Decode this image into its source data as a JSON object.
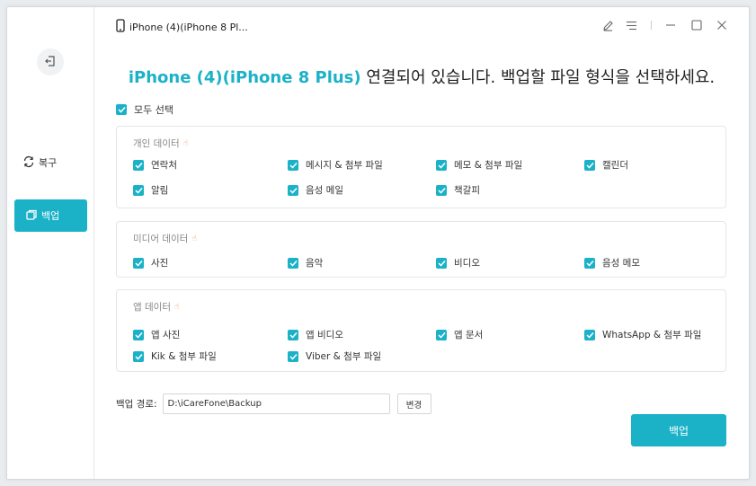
{
  "device": {
    "name": "iPhone (4)(iPhone 8 Pl..."
  },
  "sidebar": {
    "restore_label": "복구",
    "backup_label": "백업"
  },
  "headline": {
    "device_highlight": "iPhone (4)(iPhone 8 Plus)",
    "message": " 연결되어 있습니다. 백업할 파일 형식을 선택하세요."
  },
  "select_all": {
    "label": "모두 선택",
    "checked": true
  },
  "groups": [
    {
      "title": "개인 데이터",
      "items": [
        {
          "label": "연락처",
          "checked": true
        },
        {
          "label": "메시지 & 첨부 파일",
          "checked": true
        },
        {
          "label": "메모 & 첨부 파일",
          "checked": true
        },
        {
          "label": "캘린더",
          "checked": true
        },
        {
          "label": "알림",
          "checked": true
        },
        {
          "label": "음성 메일",
          "checked": true
        },
        {
          "label": "책갈피",
          "checked": true
        }
      ]
    },
    {
      "title": "미디어 데이터",
      "items": [
        {
          "label": "사진",
          "checked": true
        },
        {
          "label": "음악",
          "checked": true
        },
        {
          "label": "비디오",
          "checked": true
        },
        {
          "label": "음성 메모",
          "checked": true
        }
      ]
    },
    {
      "title": "앱 데이터",
      "items": [
        {
          "label": "앱 사진",
          "checked": true
        },
        {
          "label": "앱 비디오",
          "checked": true
        },
        {
          "label": "앱 문서",
          "checked": true
        },
        {
          "label": "WhatsApp & 첨부 파일",
          "checked": true
        },
        {
          "label": "Kik & 첨부 파일",
          "checked": true
        },
        {
          "label": "Viber & 첨부 파일",
          "checked": true
        }
      ]
    }
  ],
  "backup_path": {
    "label": "백업 경로:",
    "value": "D:\\iCareFone\\Backup",
    "change_label": "변경"
  },
  "backup_button": {
    "label": "백업"
  },
  "colors": {
    "accent": "#1bb2c8",
    "hand_icon": "#ef8f5f"
  },
  "icons": [
    "back-icon",
    "restore-icon",
    "backup-icon",
    "phone-icon",
    "feedback-icon",
    "menu-icon",
    "minimize-icon",
    "maximize-icon",
    "close-icon",
    "checkbox-checked-icon",
    "hand-icon"
  ]
}
